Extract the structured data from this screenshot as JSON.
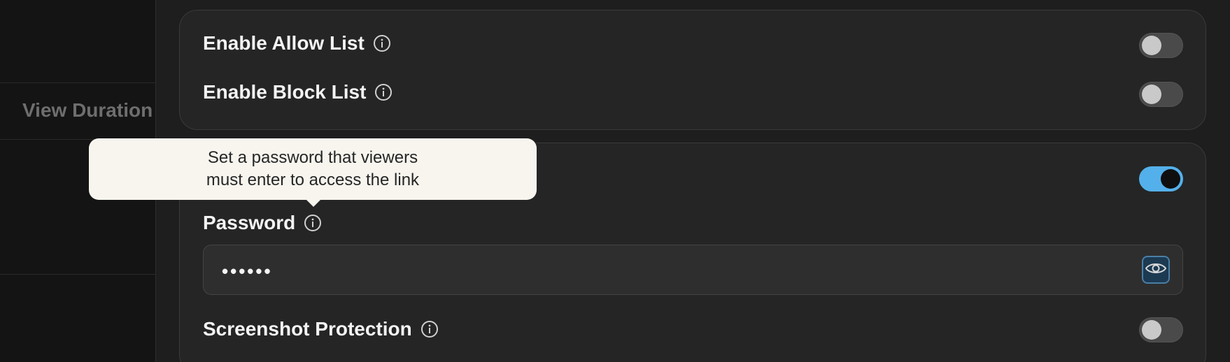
{
  "background_table": {
    "column_header": "View Duration"
  },
  "settings": {
    "allow_list": {
      "label": "Enable Allow List",
      "enabled": false
    },
    "block_list": {
      "label": "Enable Block List",
      "enabled": false
    },
    "password_protection": {
      "enabled": true
    },
    "password": {
      "label": "Password",
      "value_masked": "••••••",
      "reveal_icon": "eye-icon"
    },
    "screenshot_protection": {
      "label": "Screenshot Protection",
      "enabled": false
    }
  },
  "tooltip": {
    "line1": "Set a password that viewers",
    "line2": "must enter to access the link"
  },
  "colors": {
    "toggle_on": "#54b0ea",
    "toggle_off": "#4a4a4a",
    "tooltip_bg": "#f7f5ee"
  }
}
